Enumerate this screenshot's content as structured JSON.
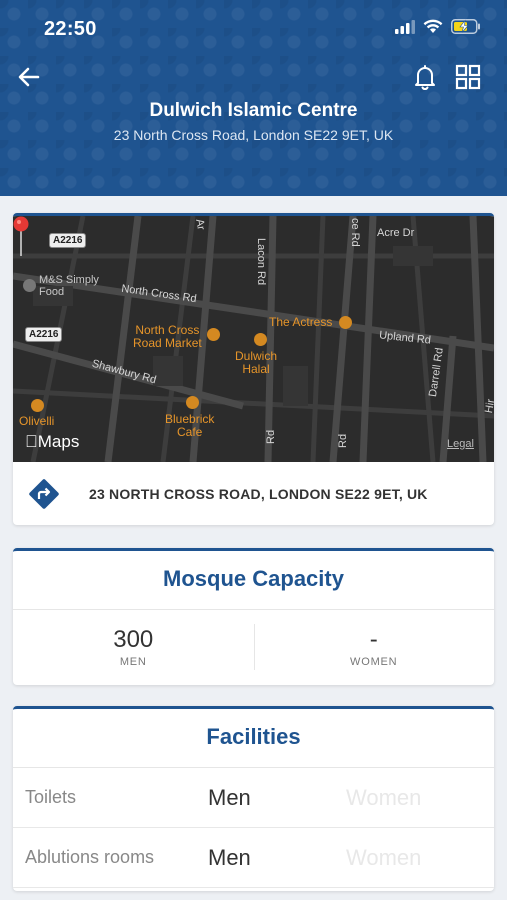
{
  "status": {
    "time": "22:50"
  },
  "header": {
    "title": "Dulwich Islamic Centre",
    "subtitle": "23 North Cross Road, London SE22 9ET, UK",
    "bg_color": "#1f5490"
  },
  "map": {
    "roads": {
      "north_cross": "North Cross Rd",
      "upland": "Upland Rd",
      "shawbury": "Shawbury Rd",
      "lacon": "Lacon Rd",
      "darrell": "Darrell Rd",
      "acre": "Acre Dr",
      "rd1": "Rd",
      "rd2": "Rd",
      "ar": "Ar",
      "ce_rd": "ce Rd",
      "hir": "Hir"
    },
    "shields": {
      "a2216_top": "A2216",
      "a2216_left": "A2216"
    },
    "places": {
      "ms": "M&S Simply\nFood",
      "north_cross_market": "North Cross\nRoad Market",
      "actress": "The Actress",
      "dulwich_halal": "Dulwich\nHalal",
      "olivelli": "Olivelli",
      "bluebrick": "Bluebrick\nCafe"
    },
    "brand": "Maps",
    "legal": "Legal"
  },
  "address": {
    "text": "23 NORTH CROSS ROAD, LONDON SE22 9ET, UK"
  },
  "capacity": {
    "title": "Mosque Capacity",
    "men_value": "300",
    "men_label": "MEN",
    "women_value": "-",
    "women_label": "WOMEN"
  },
  "facilities": {
    "title": "Facilities",
    "rows": [
      {
        "name": "Toilets",
        "men": "Men",
        "women": "Women"
      },
      {
        "name": "Ablutions rooms",
        "men": "Men",
        "women": "Women"
      }
    ]
  },
  "colors": {
    "accent": "#1f5490",
    "poi": "#e6952a",
    "pin": "#e53935"
  }
}
